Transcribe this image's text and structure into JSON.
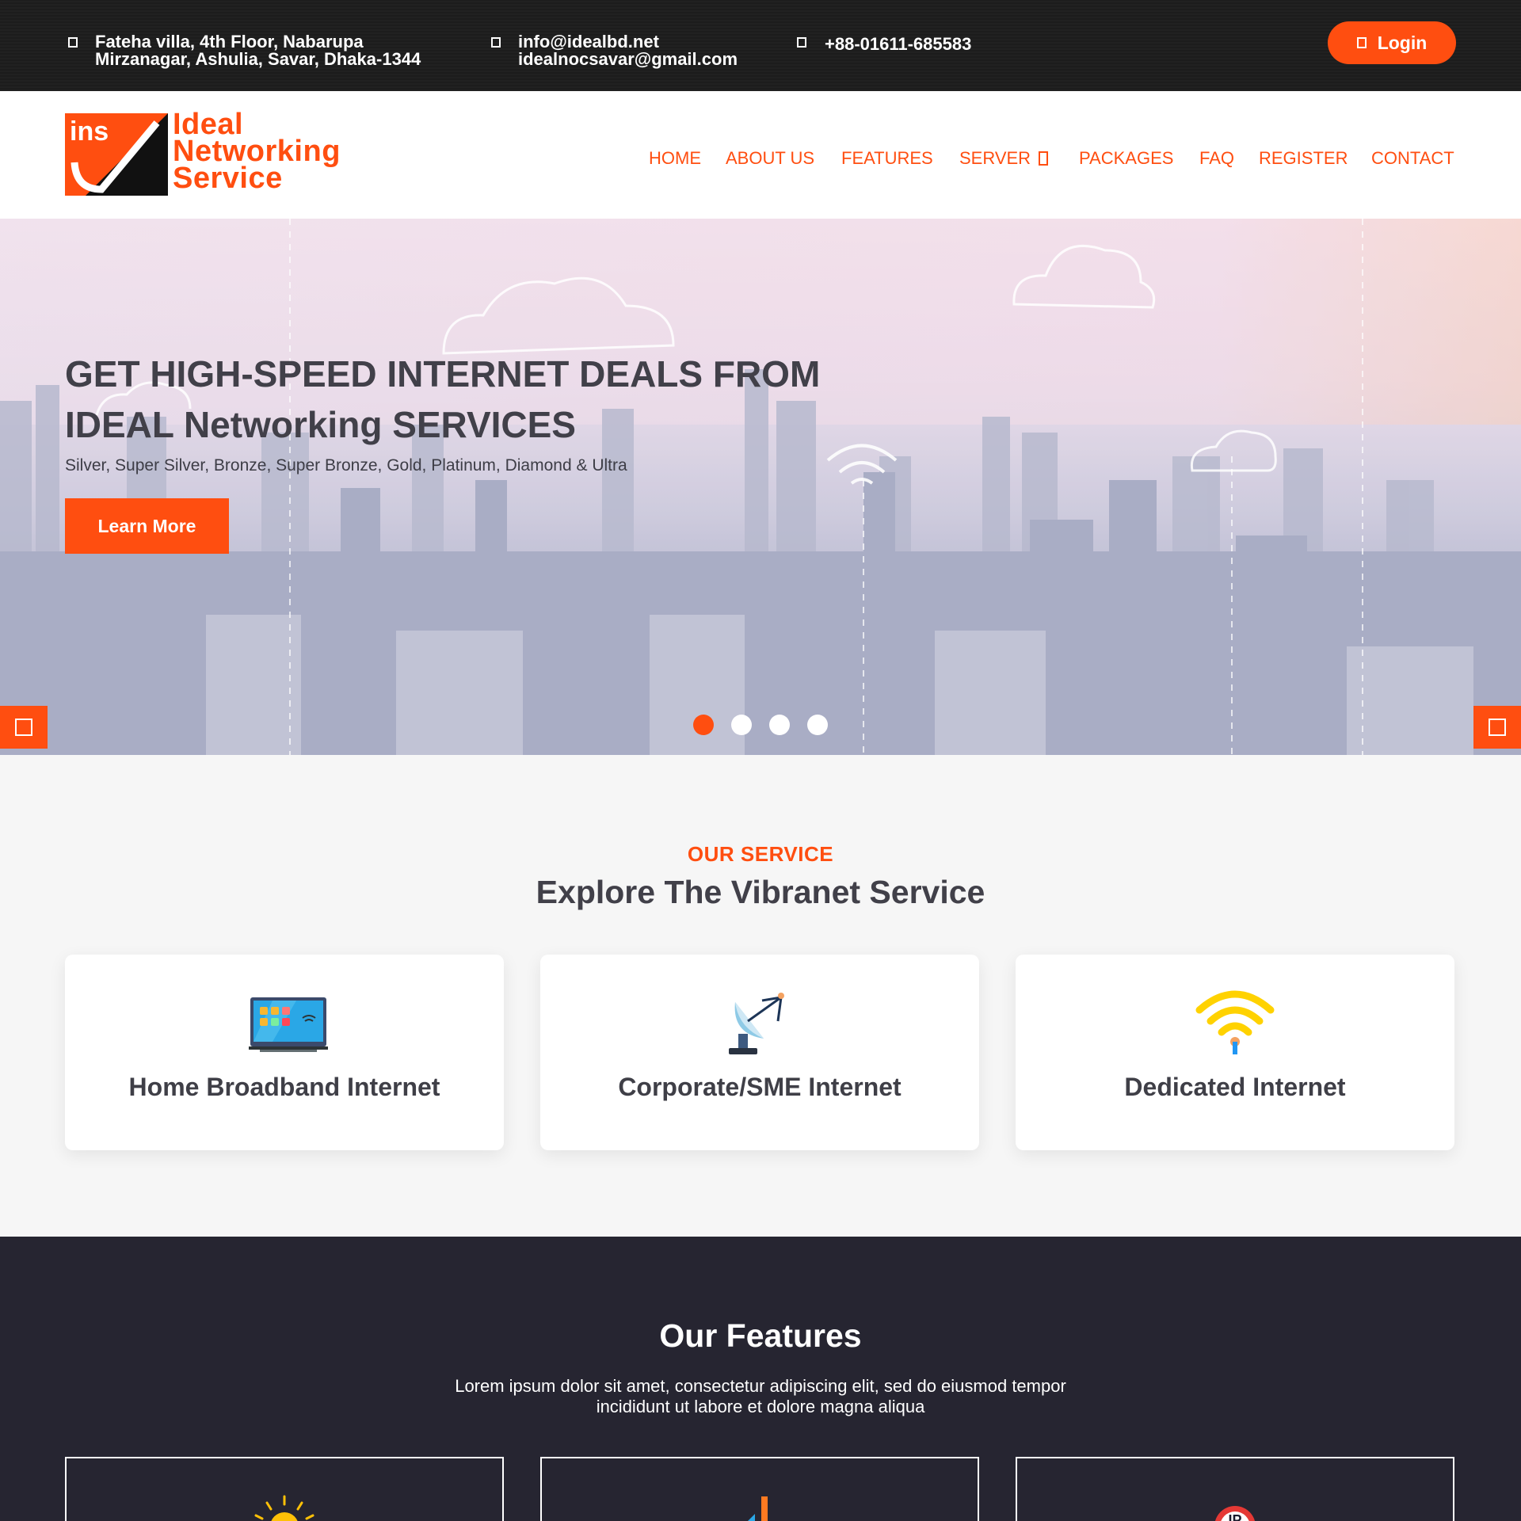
{
  "topbar": {
    "address_line1": "Fateha villa, 4th Floor, Nabarupa",
    "address_line2": "Mirzanagar, Ashulia, Savar, Dhaka-1344",
    "email_line1": "info@idealbd.net",
    "email_line2": "idealnocsavar@gmail.com",
    "phone": "+88-01611-685583",
    "login_label": "Login",
    "icons": [
      "location-icon",
      "email-icon",
      "phone-icon",
      "user-icon"
    ]
  },
  "brand": {
    "mark": "ins",
    "name_line1": "Ideal",
    "name_line2": "Networking",
    "name_line3": "Service",
    "color": "#ff4e10"
  },
  "nav": {
    "items": [
      "HOME",
      "ABOUT US",
      "FEATURES",
      "SERVER",
      "PACKAGES",
      "FAQ",
      "REGISTER",
      "CONTACT"
    ]
  },
  "hero": {
    "title_line1": "GET HIGH-SPEED INTERNET DEALS FROM",
    "title_line2": "IDEAL Networking SERVICES",
    "subtitle": "Silver, Super Silver, Bronze, Super Bronze, Gold, Platinum, Diamond & Ultra",
    "cta": "Learn More",
    "slides_total": 4,
    "active_slide": 1
  },
  "services": {
    "kicker": "OUR SERVICE",
    "title": "Explore The Vibranet Service",
    "cards": [
      {
        "title": "Home Broadband Internet",
        "icon": "tv-icon"
      },
      {
        "title": "Corporate/SME Internet",
        "icon": "satellite-dish-icon"
      },
      {
        "title": "Dedicated Internet",
        "icon": "wifi-icon"
      }
    ]
  },
  "features": {
    "title": "Our Features",
    "desc_line1": "Lorem ipsum dolor sit amet, consectetur adipiscing elit, sed do eiusmod tempor",
    "desc_line2": "incididunt ut labore et dolore magna aliqua",
    "cards": [
      {
        "icon": "sun-icon"
      },
      {
        "icon": "signal-bars-icon"
      },
      {
        "icon": "ip-badge-icon",
        "label": "IP"
      }
    ]
  },
  "colors": {
    "accent": "#ff4e10",
    "dark": "#262531",
    "topbar": "#1c1c1c",
    "text": "#414049"
  }
}
